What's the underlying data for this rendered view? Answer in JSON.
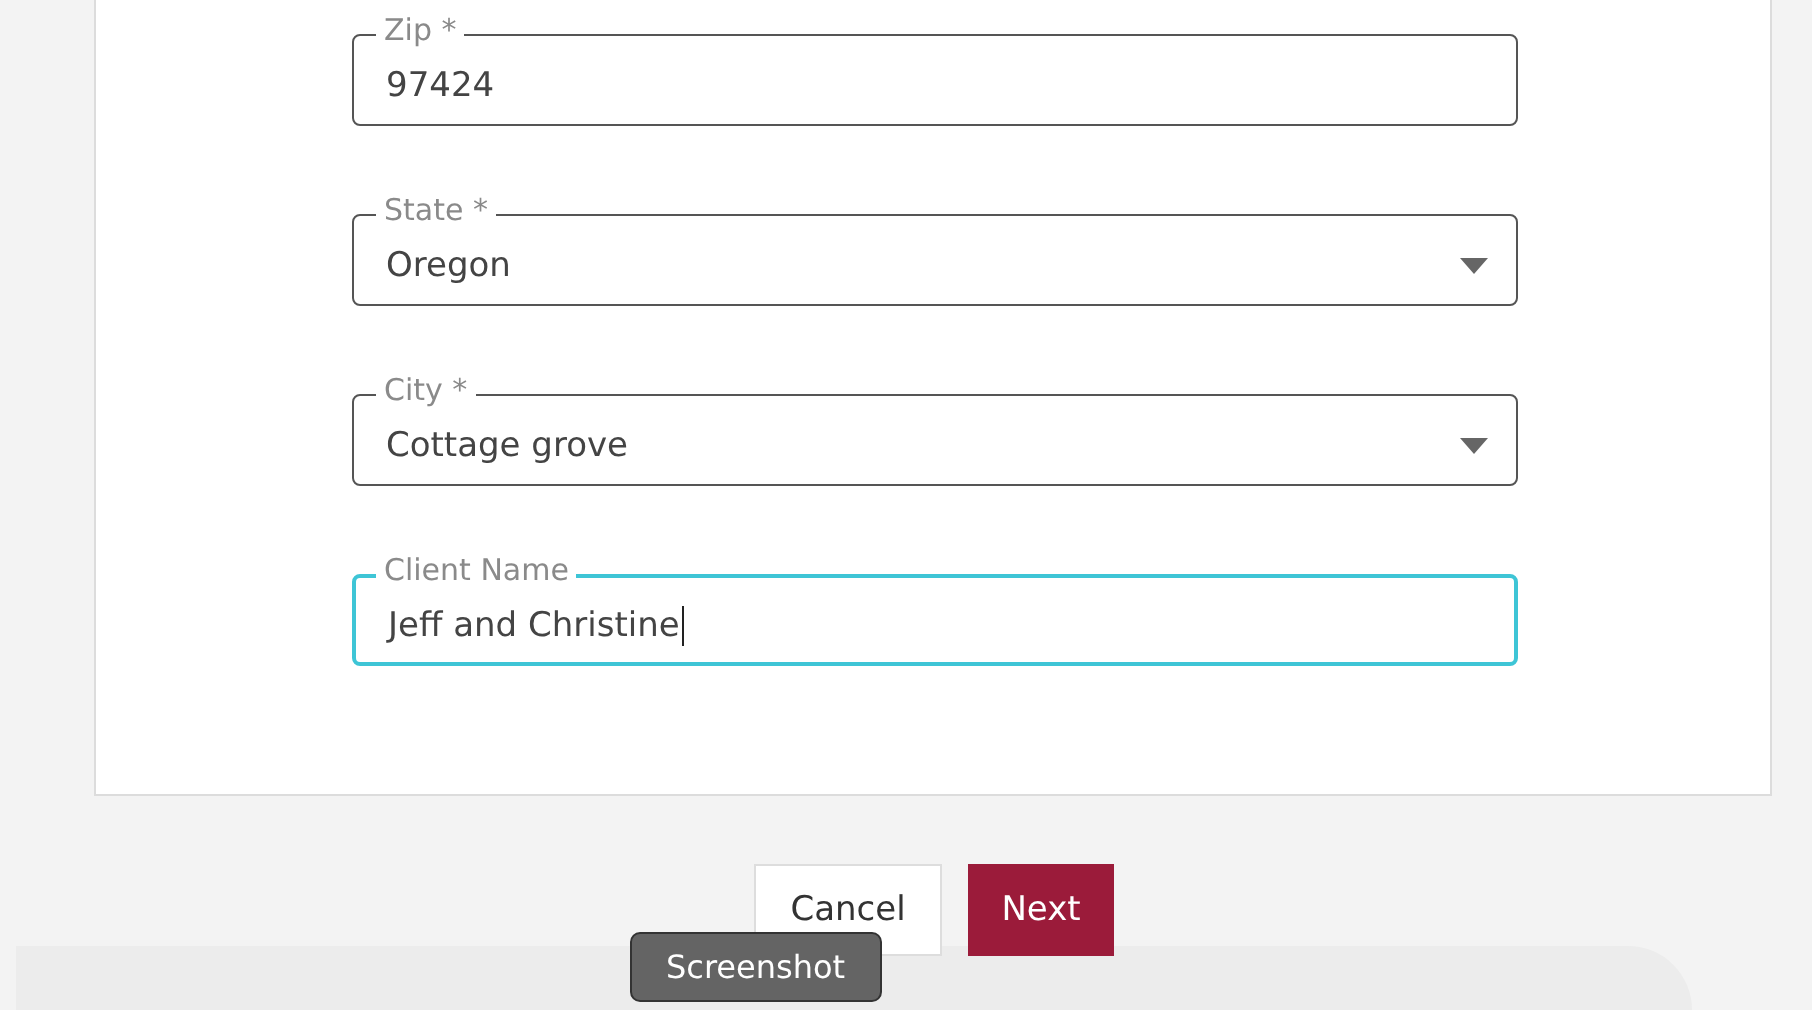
{
  "fields": [
    {
      "label": "Zip *",
      "value": "97424",
      "kind": "text",
      "focused": false
    },
    {
      "label": "State *",
      "value": "Oregon",
      "kind": "select",
      "focused": false
    },
    {
      "label": "City *",
      "value": "Cottage grove",
      "kind": "select",
      "focused": false
    },
    {
      "label": "Client Name",
      "value": "Jeff and Christine",
      "kind": "text",
      "focused": true
    }
  ],
  "buttons": [
    {
      "label": "Cancel",
      "kind": "secondary"
    },
    {
      "label": "Next",
      "kind": "primary"
    }
  ],
  "tooltip": "Screenshot"
}
